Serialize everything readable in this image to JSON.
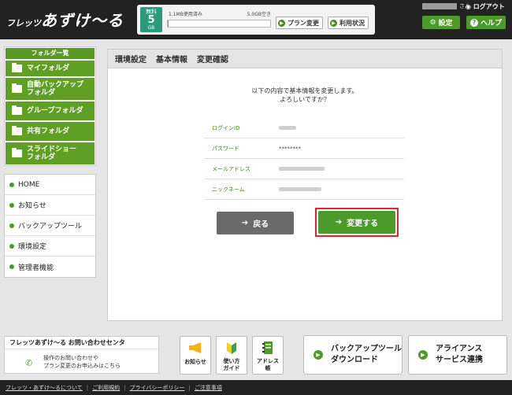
{
  "header": {
    "logo_small": "フレッツ",
    "logo_big": "あずけ〜る",
    "plan": {
      "label": "無料",
      "size": "5",
      "unit": "GB"
    },
    "usage_used": "1.1MB使用済み",
    "usage_free": "5.0GB空き",
    "usage_fraction": 0.0002,
    "plan_change_label": "プラン変更",
    "usage_status_label": "利用状況",
    "user_suffix": "さん",
    "logout_label": "ログアウト",
    "settings_label": "設定",
    "help_label": "ヘルプ"
  },
  "sidebar": {
    "folder_title": "フォルダ一覧",
    "folders": [
      "マイフォルダ",
      "自動バックアップ\nフォルダ",
      "グループフォルダ",
      "共有フォルダ",
      "スライドショー\nフォルダ"
    ],
    "nav": [
      "HOME",
      "お知らせ",
      "バックアップツール",
      "環境設定",
      "管理者機能"
    ]
  },
  "main": {
    "breadcrumb": [
      "環境設定",
      "基本情報",
      "変更確認"
    ],
    "confirm_line1": "以下の内容で基本情報を変更します。",
    "confirm_line2": "よろしいですか？",
    "fields": [
      {
        "label": "ログインID",
        "value": ""
      },
      {
        "label": "パスワード",
        "value": "********"
      },
      {
        "label": "メールアドレス",
        "value": ""
      },
      {
        "label": "ニックネーム",
        "value": ""
      }
    ],
    "back_label": "戻る",
    "submit_label": "変更する"
  },
  "contact": {
    "title": "フレッツあずけ〜る お問い合わせセンタ",
    "line1": "操作のお問い合わせや",
    "line2": "プラン変更のお申込みはこちら"
  },
  "tiles": [
    "お知らせ",
    "使い方\nガイド",
    "アドレス\n帳"
  ],
  "big_buttons": [
    "バックアップツール\nダウンロード",
    "アライアンス\nサービス連携"
  ],
  "footer_links": [
    "フレッツ・あずけ〜るについて",
    "ご利用規約",
    "プライバシーポリシー",
    "ご注意事項"
  ],
  "colors": {
    "accent_green": "#4c9a2a",
    "highlight_red": "#e0242a",
    "header_bg": "#222222"
  }
}
